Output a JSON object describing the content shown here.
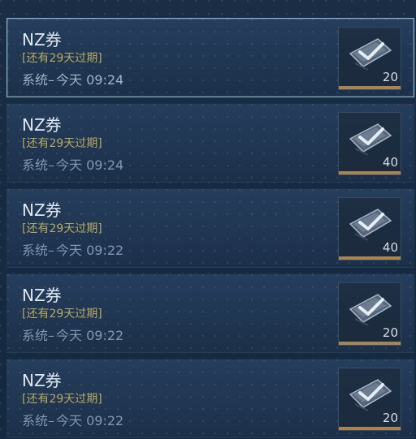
{
  "list": [
    {
      "title": "NZ券",
      "expiry": "[还有29天过期]",
      "sender": "系统",
      "separator": "–",
      "time": "今天 09:24",
      "count": "20",
      "selected": true
    },
    {
      "title": "NZ券",
      "expiry": "[还有29天过期]",
      "sender": "系统",
      "separator": "–",
      "time": "今天 09:24",
      "count": "40",
      "selected": false
    },
    {
      "title": "NZ券",
      "expiry": "[还有29天过期]",
      "sender": "系统",
      "separator": "–",
      "time": "今天 09:22",
      "count": "40",
      "selected": false
    },
    {
      "title": "NZ券",
      "expiry": "[还有29天过期]",
      "sender": "系统",
      "separator": "–",
      "time": "今天 09:22",
      "count": "20",
      "selected": false
    },
    {
      "title": "NZ券",
      "expiry": "[还有29天过期]",
      "sender": "系统",
      "separator": "–",
      "time": "今天 09:22",
      "count": "20",
      "selected": false
    }
  ],
  "icon": "voucher-icon",
  "colors": {
    "background": "#162a41",
    "selected_border": "#8fb2c9",
    "expiry_text": "#b5a860",
    "title_text": "#dfe8f2",
    "meta_text": "#7f96b0",
    "thumb_underline": "#a88450"
  }
}
